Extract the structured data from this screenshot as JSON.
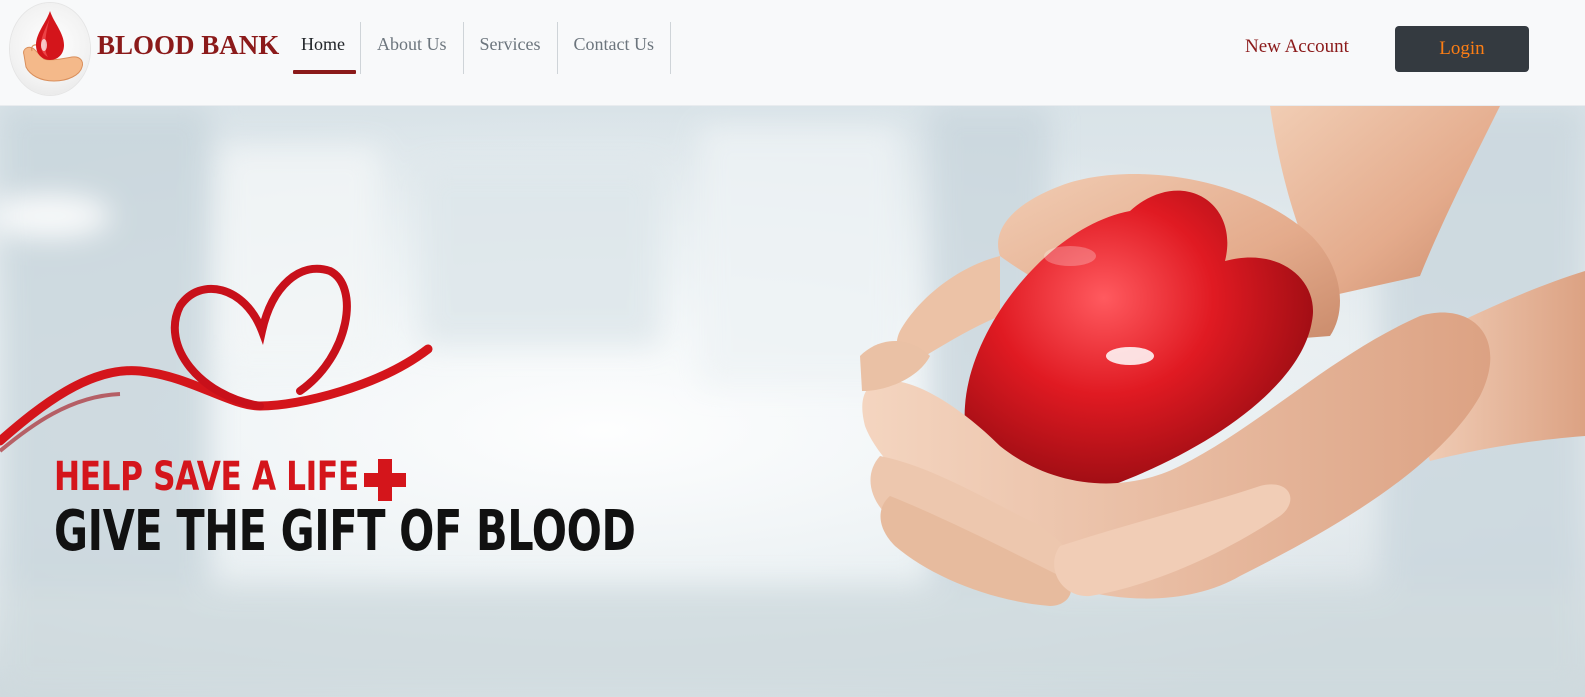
{
  "header": {
    "brand": "BLOOD BANK",
    "nav": [
      {
        "label": "Home",
        "active": true
      },
      {
        "label": "About Us",
        "active": false
      },
      {
        "label": "Services",
        "active": false
      },
      {
        "label": "Contact Us",
        "active": false
      }
    ],
    "new_account": "New Account",
    "login": "Login"
  },
  "hero": {
    "tagline_top": "HELP SAVE A LIFE",
    "tagline_bottom": "GIVE THE GIFT OF BLOOD",
    "icons": [
      "ribbon-heart-icon",
      "red-cross-icon",
      "heart-in-hands-image"
    ]
  },
  "colors": {
    "brand": "#8b1a1a",
    "accent_red": "#d4151b",
    "login_bg": "#343a40",
    "login_text": "#fd7e14"
  }
}
